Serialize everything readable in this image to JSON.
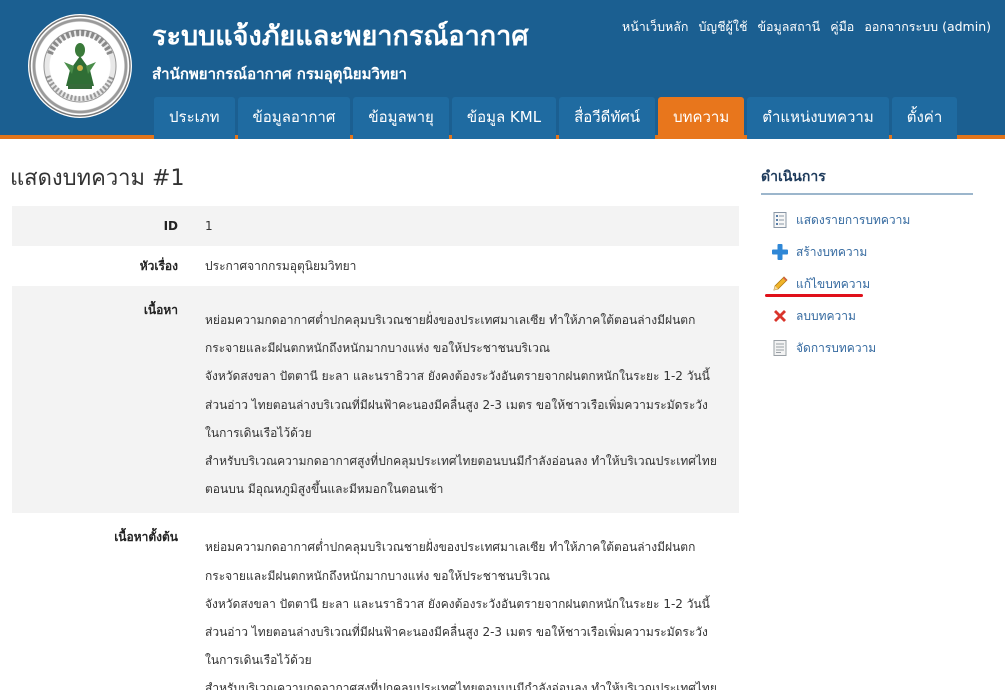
{
  "header": {
    "logo_text": "กรมอุตุนิยมวิทยา METEOROLOGICAL DEPARTMENT",
    "title": "ระบบแจ้งภัยและพยากรณ์อากาศ",
    "subtitle": "สำนักพยากรณ์อากาศ กรมอุตุนิยมวิทยา",
    "top_links": [
      "หน้าเว็บหลัก",
      "บัญชีผู้ใช้",
      "ข้อมูลสถานี",
      "คู่มือ",
      "ออกจากระบบ (admin)"
    ],
    "accent_color": "#e8761c",
    "header_color": "#1b5f91"
  },
  "nav": {
    "tabs": [
      "ประเภท",
      "ข้อมูลอากาศ",
      "ข้อมูลพายุ",
      "ข้อมูล KML",
      "สื่อวีดีทัศน์",
      "บทความ",
      "ตำแหน่งบทความ",
      "ตั้งค่า"
    ],
    "active": "บทความ"
  },
  "page": {
    "title": "แสดงบทความ #1"
  },
  "detail": {
    "id_label": "ID",
    "id_value": "1",
    "subject_label": "หัวเรื่อง",
    "subject_value": "ประกาศจากกรมอุตุนิยมวิทยา",
    "content_label": "เนื้อหา",
    "content_lines": [
      "หย่อมความกดอากาศต่ำปกคลุมบริเวณชายฝั่งของประเทศมาเลเซีย ทำให้ภาคใต้ตอนล่างมีฝนตก",
      "กระจายและมีฝนตกหนักถึงหนักมากบางแห่ง ขอให้ประชาชนบริเวณ",
      "จังหวัดสงขลา ปัตตานี ยะลา และนราธิวาส ยังคงต้องระวังอันตรายจากฝนตกหนักในระยะ 1-2 วันนี้",
      "ส่วนอ่าว ไทยตอนล่างบริเวณที่มีฝนฟ้าคะนองมีคลื่นสูง 2-3 เมตร ขอให้ชาวเรือเพิ่มความระมัดระวัง",
      "ในการเดินเรือไว้ด้วย",
      "สำหรับบริเวณความกดอากาศสูงที่ปกคลุมประเทศไทยตอนบนมีกำลังอ่อนลง ทำให้บริเวณประเทศไทย",
      "ตอนบน มีอุณหภูมิสูงขึ้นและมีหมอกในตอนเช้า"
    ],
    "original_label": "เนื้อหาตั้งต้น",
    "original_lines": [
      "หย่อมความกดอากาศต่ำปกคลุมบริเวณชายฝั่งของประเทศมาเลเซีย ทำให้ภาคใต้ตอนล่างมีฝนตก",
      "กระจายและมีฝนตกหนักถึงหนักมากบางแห่ง ขอให้ประชาชนบริเวณ",
      "จังหวัดสงขลา ปัตตานี ยะลา และนราธิวาส ยังคงต้องระวังอันตรายจากฝนตกหนักในระยะ 1-2 วันนี้",
      "ส่วนอ่าว ไทยตอนล่างบริเวณที่มีฝนฟ้าคะนองมีคลื่นสูง 2-3 เมตร ขอให้ชาวเรือเพิ่มความระมัดระวัง",
      "ในการเดินเรือไว้ด้วย",
      "สำหรับบริเวณความกดอากาศสูงที่ปกคลุมประเทศไทยตอนบนมีกำลังอ่อนลง ทำให้บริเวณประเทศไทย"
    ]
  },
  "sidebar": {
    "title": "ดำเนินการ",
    "operations": [
      {
        "label": "แสดงรายการบทความ",
        "icon": "list-icon"
      },
      {
        "label": "สร้างบทความ",
        "icon": "plus-icon"
      },
      {
        "label": "แก้ไขบทความ",
        "icon": "pencil-icon"
      },
      {
        "label": "ลบบทความ",
        "icon": "delete-icon"
      },
      {
        "label": "จัดการบทความ",
        "icon": "manage-icon"
      }
    ],
    "highlight_color": "#e0101a"
  }
}
